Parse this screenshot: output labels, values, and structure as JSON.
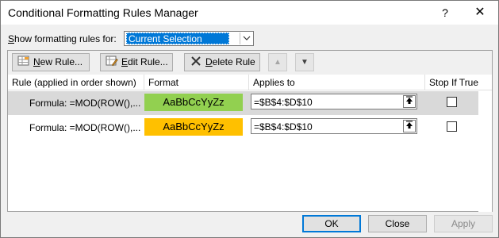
{
  "window": {
    "title": "Conditional Formatting Rules Manager",
    "help_glyph": "?",
    "close_glyph": "✕"
  },
  "show_rules": {
    "label_prefix": "",
    "label_underlined": "S",
    "label_rest": "how formatting rules for:",
    "selected": "Current Selection"
  },
  "toolbar": {
    "new_rule": {
      "prefix": "",
      "underline": "N",
      "rest": "ew Rule..."
    },
    "edit_rule": {
      "prefix": "",
      "underline": "E",
      "rest": "dit Rule..."
    },
    "delete_rule": {
      "prefix": "",
      "underline": "D",
      "rest": "elete Rule"
    },
    "move_up_glyph": "▲",
    "move_down_glyph": "▼"
  },
  "grid": {
    "headers": {
      "rule": "Rule (applied in order shown)",
      "format": "Format",
      "applies_to": "Applies to",
      "stop_if_true": "Stop If True"
    },
    "rows": [
      {
        "rule": "Formula: =MOD(ROW(),...",
        "format_preview": "AaBbCcYyZz",
        "format_color": "#92d050",
        "applies_to": "=$B$4:$D$10",
        "stop_if_true": false
      },
      {
        "rule": "Formula: =MOD(ROW(),...",
        "format_preview": "AaBbCcYyZz",
        "format_color": "#ffc000",
        "applies_to": "=$B$4:$D$10",
        "stop_if_true": false
      }
    ]
  },
  "footer": {
    "ok": "OK",
    "close": "Close",
    "apply": "Apply"
  },
  "colors": {
    "selection_blue": "#0078d7",
    "selected_row": "#d9d9d9"
  }
}
